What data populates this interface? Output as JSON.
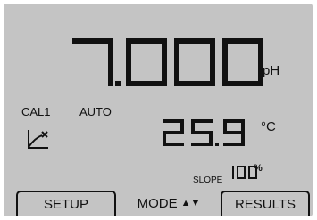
{
  "display": {
    "ph_value": "7.000",
    "ph_unit": "pH",
    "temperature_value": "25.9",
    "temperature_unit": "°C",
    "calibration_label": "CAL1",
    "mode_label": "AUTO",
    "slope_label": "SLOPE",
    "slope_value": "100",
    "slope_unit": "%"
  },
  "softkeys": {
    "setup": "SETUP",
    "mode": "MODE",
    "mode_arrows": "▲▼",
    "results": "RESULTS"
  },
  "icons": {
    "calibration": "calibration-slope-icon"
  },
  "colors": {
    "lcd_background": "#c4c4c4",
    "segment": "#111111"
  }
}
